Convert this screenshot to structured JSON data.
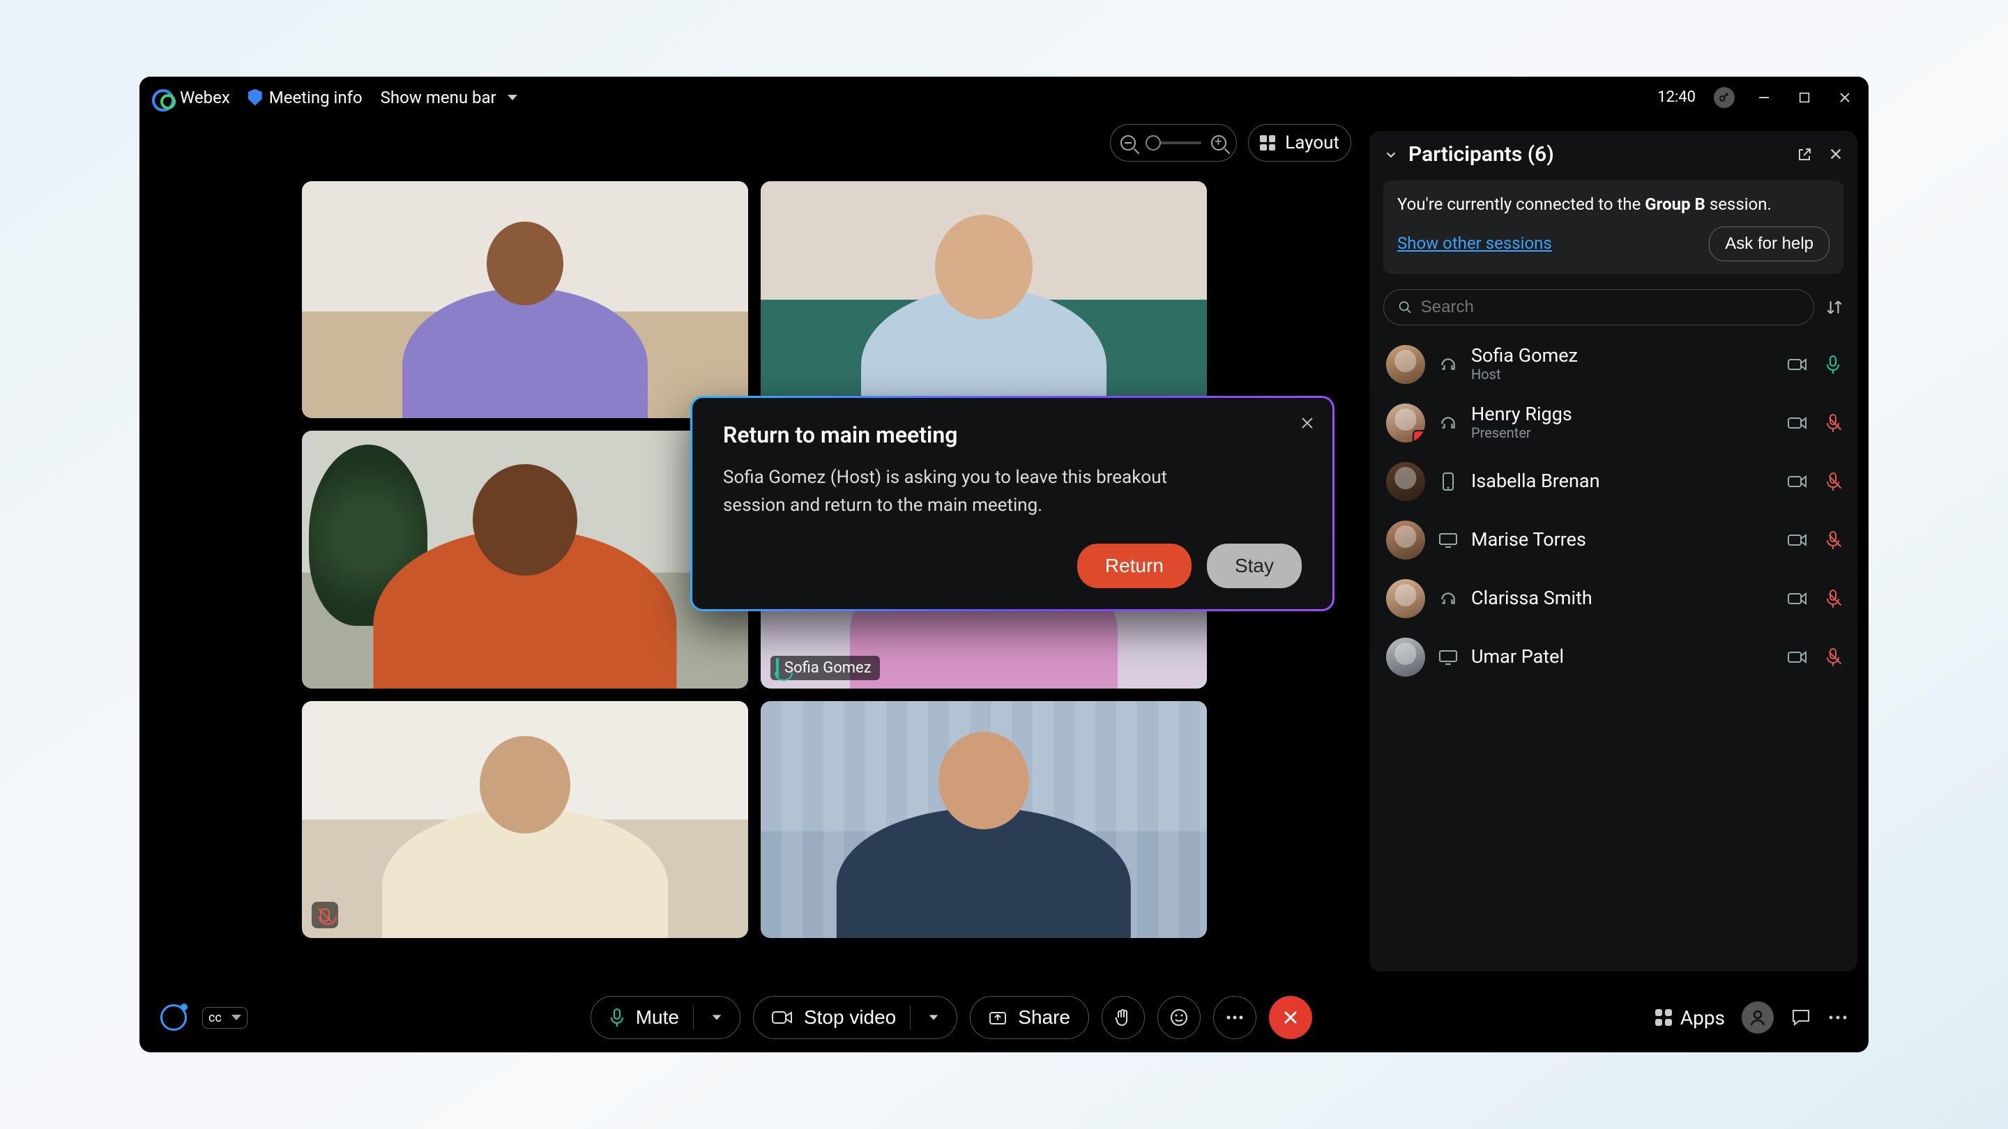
{
  "titlebar": {
    "app_name": "Webex",
    "meeting_info": "Meeting info",
    "show_menu": "Show menu bar",
    "clock": "12:40"
  },
  "stage": {
    "layout_label": "Layout",
    "speaking_tile_name": "Sofia Gomez"
  },
  "participants_panel": {
    "heading": "Participants (6)",
    "session_notice_prefix": "You're currently connected to the ",
    "session_name": "Group B",
    "session_notice_suffix": " session.",
    "show_other_link": "Show other sessions",
    "ask_help_label": "Ask for help",
    "search_placeholder": "Search",
    "list": [
      {
        "name": "Sofia Gomez",
        "role": "Host",
        "device": "headset",
        "mic": "on"
      },
      {
        "name": "Henry Riggs",
        "role": "Presenter",
        "device": "headset",
        "mic": "off"
      },
      {
        "name": "Isabella Brenan",
        "role": "",
        "device": "mobile",
        "mic": "off"
      },
      {
        "name": "Marise Torres",
        "role": "",
        "device": "desktop",
        "mic": "off"
      },
      {
        "name": "Clarissa Smith",
        "role": "",
        "device": "headset",
        "mic": "off"
      },
      {
        "name": "Umar Patel",
        "role": "",
        "device": "desktop",
        "mic": "off"
      }
    ]
  },
  "modal": {
    "title": "Return to main meeting",
    "body": "Sofia Gomez (Host) is asking you to leave this breakout session and return to the main meeting.",
    "primary": "Return",
    "secondary": "Stay"
  },
  "toolbar": {
    "cc": "cc",
    "mute_label": "Mute",
    "stop_video_label": "Stop video",
    "share_label": "Share",
    "apps_label": "Apps"
  }
}
